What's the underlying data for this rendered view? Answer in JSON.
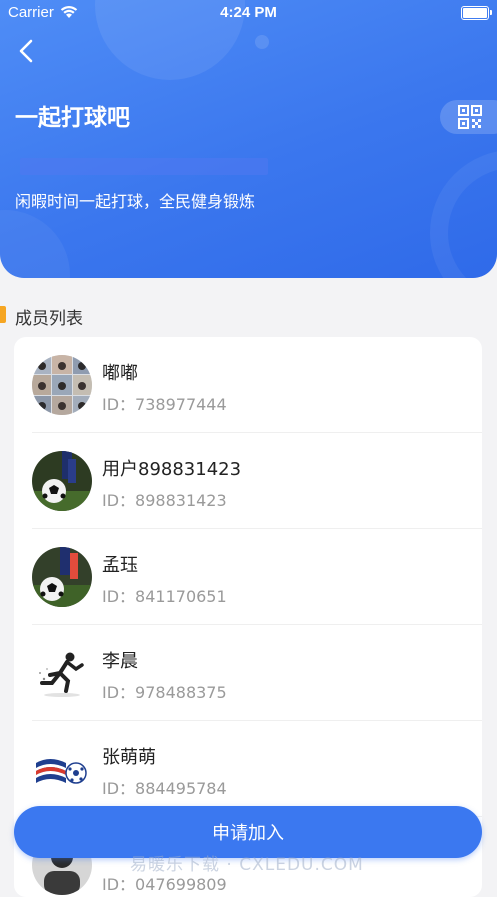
{
  "status_bar": {
    "carrier": "Carrier",
    "time": "4:24 PM"
  },
  "header": {
    "title": "一起打球吧",
    "description": "闲暇时间一起打球，全民健身锻炼"
  },
  "section": {
    "title": "成员列表"
  },
  "members": [
    {
      "name": "嘟嘟",
      "id_text": "ID：738977444",
      "avatar": "photo-grid-avatar"
    },
    {
      "name": "用户898831423",
      "id_text": "ID：898831423",
      "avatar": "soccer-ball-avatar"
    },
    {
      "name": "孟珏",
      "id_text": "ID：841170651",
      "avatar": "soccer-ball-avatar"
    },
    {
      "name": "李晨",
      "id_text": "ID：978488375",
      "avatar": "runner-avatar"
    },
    {
      "name": "张萌萌",
      "id_text": "ID：884495784",
      "avatar": "flag-ball-avatar"
    },
    {
      "name": "",
      "id_text": "ID：047699809",
      "avatar": "person-avatar"
    }
  ],
  "join_button": {
    "label": "申请加入"
  },
  "watermark": "易暖乐下载 · CXLEDU.COM",
  "colors": {
    "primary": "#3b78f0",
    "accent": "#f6a623",
    "background": "#f3f3f5"
  }
}
